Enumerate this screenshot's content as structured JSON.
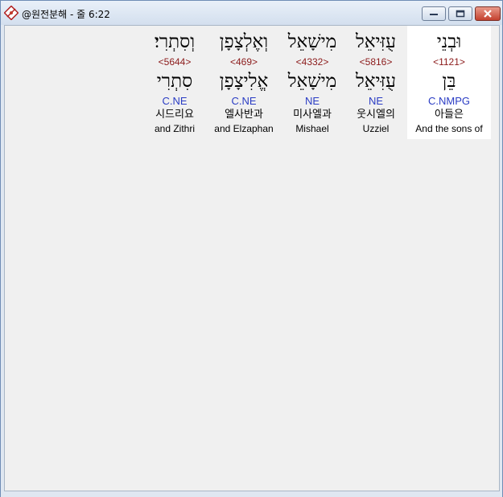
{
  "window": {
    "title": "@원전분해 - 줄 6:22"
  },
  "words": [
    {
      "hebrew": "וּבְנֵי",
      "strong": "<1121>",
      "lexeme": "בֵּן",
      "morph": "C.NMPG",
      "korean": "아들은",
      "english": "And the sons of",
      "active": true
    },
    {
      "hebrew": "עֻזִּיאֵל",
      "strong": "<5816>",
      "lexeme": "עֻזִּיאֵל",
      "morph": "NE",
      "korean": "웃시엘의",
      "english": "Uzziel",
      "active": false
    },
    {
      "hebrew": "מִישָׁאֵל",
      "strong": "<4332>",
      "lexeme": "מִישָׁאֵל",
      "morph": "NE",
      "korean": "미사엘과",
      "english": "Mishael",
      "active": false
    },
    {
      "hebrew": "וְאֶלְצָפָן",
      "strong": "<469>",
      "lexeme": "אֱלִיצָפָן",
      "morph": "C.NE",
      "korean": "엘사반과",
      "english": "and Elzaphan",
      "active": false
    },
    {
      "hebrew": "וְסִתְרִי׃",
      "strong": "<5644>",
      "lexeme": "סִתְרִי",
      "morph": "C.NE",
      "korean": "시드리요",
      "english": "and Zithri",
      "active": false
    }
  ]
}
